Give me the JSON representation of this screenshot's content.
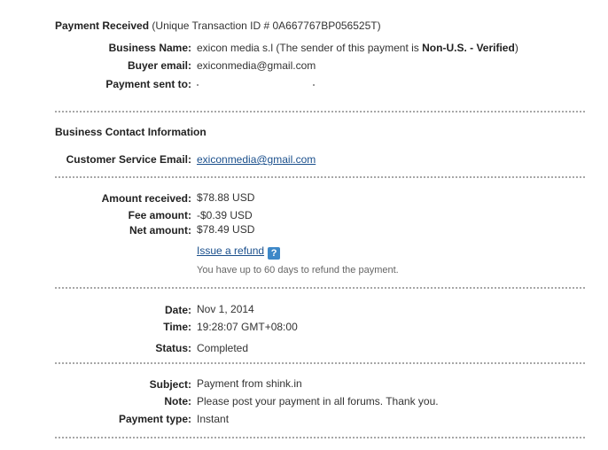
{
  "header": {
    "title": "Payment Received",
    "transaction_text": "(Unique Transaction ID # 0A667767BP056525T)"
  },
  "business": {
    "name_label": "Business Name:",
    "name_value": "exicon media s.l (The sender of this payment is ",
    "name_status": "Non-U.S. - Verified",
    "name_close": ")",
    "email_label": "Buyer email:",
    "email_value": "exiconmedia@gmail.com",
    "sent_to_label": "Payment sent to:",
    "sent_to_value": ""
  },
  "contact": {
    "section_title": "Business Contact Information",
    "cs_email_label": "Customer Service Email:",
    "cs_email_value": "exiconmedia@gmail.com"
  },
  "amounts": {
    "received_label": "Amount received:",
    "received_value": "$78.88 USD",
    "fee_label": "Fee amount:",
    "fee_value": "-$0.39 USD",
    "net_label": "Net amount:",
    "net_value": "$78.49 USD",
    "refund_link": "Issue a refund",
    "help_icon": "?",
    "refund_note": "You have up to 60 days to refund the payment."
  },
  "status": {
    "date_label": "Date:",
    "date_value": "Nov 1, 2014",
    "time_label": "Time:",
    "time_value": "19:28:07 GMT+08:00",
    "status_label": "Status:",
    "status_value": "Completed"
  },
  "details": {
    "subject_label": "Subject:",
    "subject_value": "Payment from shink.in",
    "note_label": "Note:",
    "note_value": "Please post your payment in all forums. Thank you.",
    "type_label": "Payment type:",
    "type_value": "Instant"
  },
  "colors": {
    "link": "#1a4f8c",
    "help_icon_bg": "#3d88c8",
    "divider": "#a7a7a7"
  }
}
